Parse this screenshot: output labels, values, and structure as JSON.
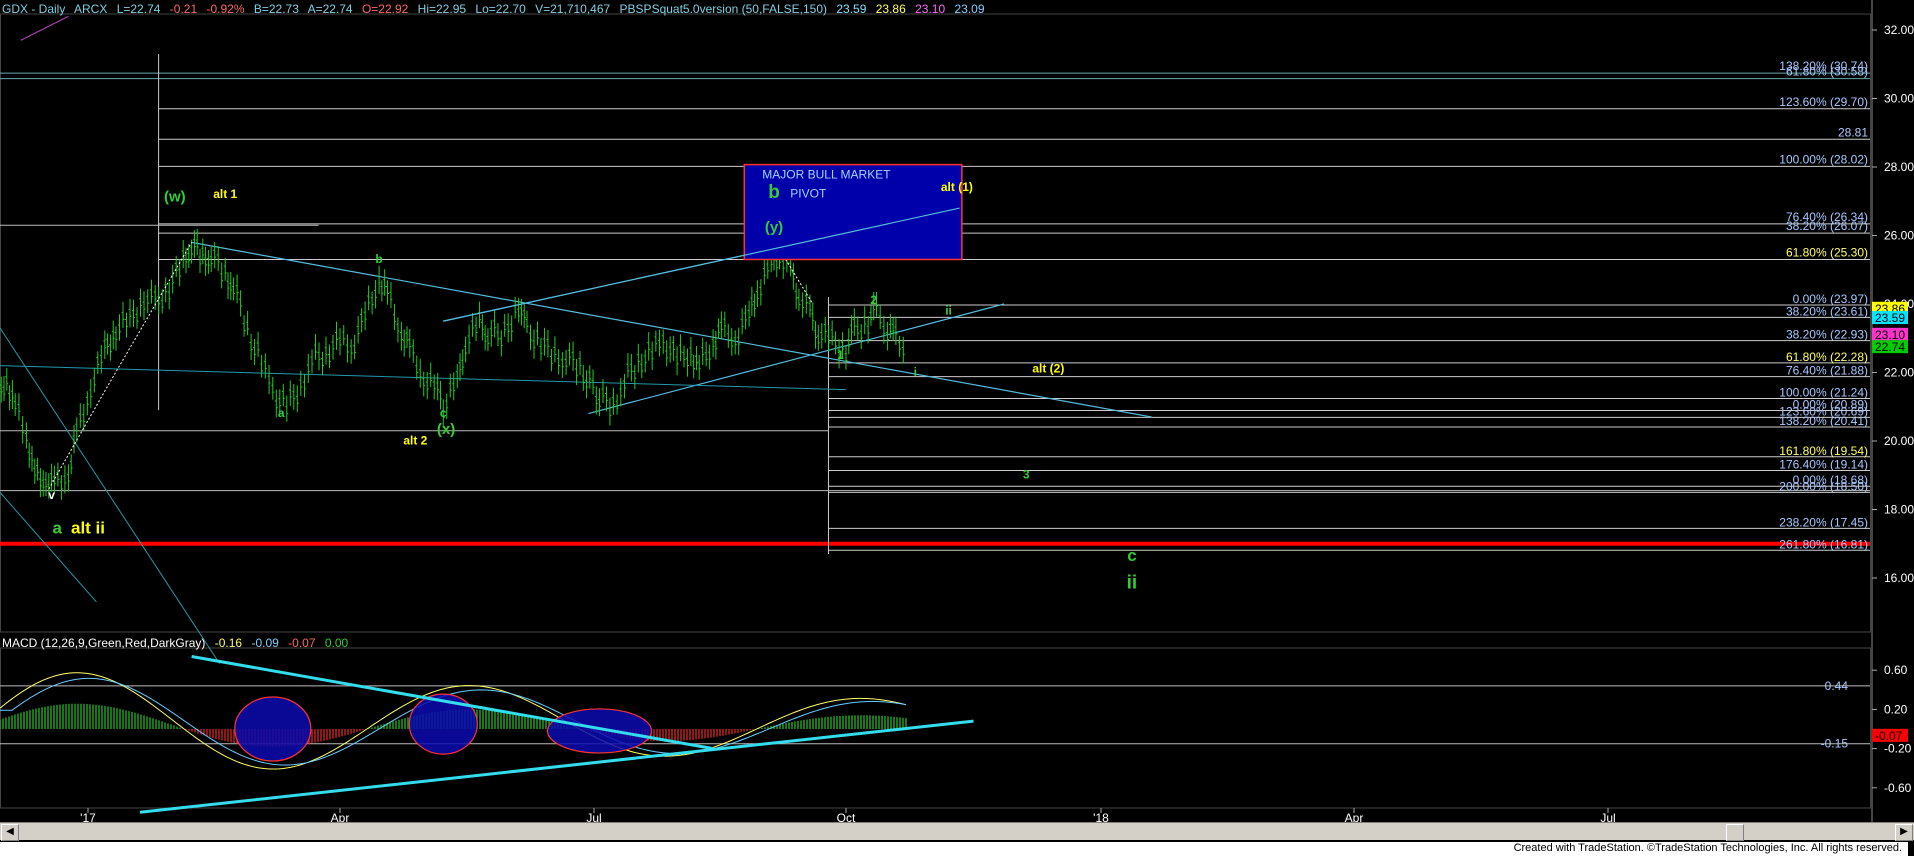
{
  "header": {
    "symbol": "GDX - Daily",
    "exchange": "ARCX",
    "last": "L=22.74",
    "change": "-0.21",
    "pct": "-0.92%",
    "bid": "B=22.73",
    "ask": "A=22.74",
    "open": "O=22.92",
    "high": "Hi=22.95",
    "low": "Lo=22.70",
    "volume": "V=21,710,467",
    "study": "PBSPSquat5.0version (50,FALSE,150)",
    "s1": "23.59",
    "s2": "23.86",
    "s3": "23.10",
    "s4": "23.09",
    "colors": {
      "s1": "#7fe0ff",
      "s2": "#ffff66",
      "s3": "#ff66ff",
      "s4": "#7fd0ff"
    }
  },
  "macd_header": {
    "label": "MACD (12,26,9,Green,Red,DarkGray)",
    "v1": "-0.16",
    "v2": "-0.09",
    "v3": "-0.07",
    "v4": "0.00"
  },
  "footer": {
    "text": "Created with TradeStation. ©TradeStation Technologies, Inc. All rights reserved."
  },
  "chart_data": [
    {
      "type": "candlestick",
      "title": "GDX - Daily",
      "x_ticks": [
        "'17",
        "Apr",
        "Jul",
        "Oct",
        "'18",
        "Apr",
        "Jul"
      ],
      "y_ticks": [
        16.0,
        18.0,
        20.0,
        22.0,
        24.0,
        26.0,
        28.0,
        30.0,
        32.0
      ],
      "ylim": [
        15.0,
        32.5
      ],
      "price_path": [
        {
          "x": "2016-12-01",
          "y": 21.4
        },
        {
          "x": "2016-12-05",
          "y": 21.8
        },
        {
          "x": "2016-12-08",
          "y": 21.0
        },
        {
          "x": "2016-12-12",
          "y": 20.2
        },
        {
          "x": "2016-12-15",
          "y": 19.0
        },
        {
          "x": "2016-12-19",
          "y": 18.9
        },
        {
          "x": "2016-12-22",
          "y": 18.7
        },
        {
          "x": "2016-12-27",
          "y": 19.1
        },
        {
          "x": "2016-12-30",
          "y": 20.2
        },
        {
          "x": "2017-01-04",
          "y": 21.6
        },
        {
          "x": "2017-01-09",
          "y": 22.6
        },
        {
          "x": "2017-01-13",
          "y": 23.3
        },
        {
          "x": "2017-01-18",
          "y": 23.5
        },
        {
          "x": "2017-01-23",
          "y": 24.2
        },
        {
          "x": "2017-01-27",
          "y": 24.0
        },
        {
          "x": "2017-02-01",
          "y": 24.5
        },
        {
          "x": "2017-02-06",
          "y": 25.2
        },
        {
          "x": "2017-02-09",
          "y": 25.8
        },
        {
          "x": "2017-02-13",
          "y": 25.3
        },
        {
          "x": "2017-02-16",
          "y": 25.5
        },
        {
          "x": "2017-02-21",
          "y": 24.8
        },
        {
          "x": "2017-02-24",
          "y": 24.6
        },
        {
          "x": "2017-03-01",
          "y": 23.2
        },
        {
          "x": "2017-03-06",
          "y": 22.3
        },
        {
          "x": "2017-03-10",
          "y": 21.4
        },
        {
          "x": "2017-03-15",
          "y": 21.0
        },
        {
          "x": "2017-03-20",
          "y": 21.6
        },
        {
          "x": "2017-03-24",
          "y": 22.4
        },
        {
          "x": "2017-03-29",
          "y": 22.6
        },
        {
          "x": "2017-04-03",
          "y": 22.9
        },
        {
          "x": "2017-04-07",
          "y": 22.7
        },
        {
          "x": "2017-04-12",
          "y": 23.6
        },
        {
          "x": "2017-04-17",
          "y": 24.8
        },
        {
          "x": "2017-04-20",
          "y": 24.3
        },
        {
          "x": "2017-04-25",
          "y": 23.2
        },
        {
          "x": "2017-04-28",
          "y": 22.7
        },
        {
          "x": "2017-05-03",
          "y": 21.9
        },
        {
          "x": "2017-05-08",
          "y": 21.4
        },
        {
          "x": "2017-05-10",
          "y": 21.0
        },
        {
          "x": "2017-05-15",
          "y": 21.7
        },
        {
          "x": "2017-05-18",
          "y": 22.9
        },
        {
          "x": "2017-05-23",
          "y": 23.4
        },
        {
          "x": "2017-05-26",
          "y": 23.2
        },
        {
          "x": "2017-06-01",
          "y": 23.1
        },
        {
          "x": "2017-06-06",
          "y": 24.0
        },
        {
          "x": "2017-06-09",
          "y": 23.2
        },
        {
          "x": "2017-06-14",
          "y": 22.9
        },
        {
          "x": "2017-06-19",
          "y": 22.4
        },
        {
          "x": "2017-06-23",
          "y": 22.5
        },
        {
          "x": "2017-06-28",
          "y": 22.1
        },
        {
          "x": "2017-07-05",
          "y": 21.3
        },
        {
          "x": "2017-07-10",
          "y": 21.0
        },
        {
          "x": "2017-07-14",
          "y": 21.8
        },
        {
          "x": "2017-07-19",
          "y": 22.3
        },
        {
          "x": "2017-07-24",
          "y": 22.6
        },
        {
          "x": "2017-07-28",
          "y": 22.9
        },
        {
          "x": "2017-08-02",
          "y": 22.4
        },
        {
          "x": "2017-08-07",
          "y": 22.6
        },
        {
          "x": "2017-08-10",
          "y": 22.2
        },
        {
          "x": "2017-08-15",
          "y": 22.9
        },
        {
          "x": "2017-08-18",
          "y": 23.3
        },
        {
          "x": "2017-08-23",
          "y": 23.0
        },
        {
          "x": "2017-08-28",
          "y": 23.6
        },
        {
          "x": "2017-08-31",
          "y": 24.4
        },
        {
          "x": "2017-09-05",
          "y": 25.1
        },
        {
          "x": "2017-09-08",
          "y": 25.5
        },
        {
          "x": "2017-09-12",
          "y": 24.9
        },
        {
          "x": "2017-09-15",
          "y": 24.3
        },
        {
          "x": "2017-09-19",
          "y": 23.7
        },
        {
          "x": "2017-09-22",
          "y": 23.2
        },
        {
          "x": "2017-09-27",
          "y": 22.9
        },
        {
          "x": "2017-10-02",
          "y": 22.7
        },
        {
          "x": "2017-10-05",
          "y": 23.2
        },
        {
          "x": "2017-10-10",
          "y": 23.5
        },
        {
          "x": "2017-10-13",
          "y": 23.8
        },
        {
          "x": "2017-10-17",
          "y": 23.3
        },
        {
          "x": "2017-10-20",
          "y": 23.0
        },
        {
          "x": "2017-10-24",
          "y": 22.74
        }
      ],
      "fib_levels_top": [
        {
          "label": "138.20% (30.74)",
          "y": 30.74
        },
        {
          "label": "61.80% (30.58)",
          "y": 30.58
        },
        {
          "label": "123.60% (29.70)",
          "y": 29.7
        },
        {
          "label": "28.81",
          "y": 28.81
        },
        {
          "label": "100.00% (28.02)",
          "y": 28.02
        },
        {
          "label": "76.40% (26.34)",
          "y": 26.34
        },
        {
          "label": "38.20% (26.07)",
          "y": 26.07
        },
        {
          "label": "61.80% (25.30)",
          "y": 25.3
        }
      ],
      "fib_levels_bottom": [
        {
          "label": "0.00% (23.97)",
          "y": 23.97
        },
        {
          "label": "38.20% (23.61)",
          "y": 23.61
        },
        {
          "label": "38.20% (22.93)",
          "y": 22.93
        },
        {
          "label": "61.80% (22.28)",
          "y": 22.28
        },
        {
          "label": "76.40% (21.88)",
          "y": 21.88
        },
        {
          "label": "100.00% (21.24)",
          "y": 21.24
        },
        {
          "label": "0.00% (20.89)",
          "y": 20.89
        },
        {
          "label": "123.60% (20.69)",
          "y": 20.69
        },
        {
          "label": "138.20% (20.41)",
          "y": 20.41
        },
        {
          "label": "161.80% (19.54)",
          "y": 19.54
        },
        {
          "label": "176.40% (19.14)",
          "y": 19.14
        },
        {
          "label": "0.00% (18.68)",
          "y": 18.68
        },
        {
          "label": "200.00% (18.50)",
          "y": 18.5
        },
        {
          "label": "238.20% (17.45)",
          "y": 17.45
        },
        {
          "label": "261.80% (16.81)",
          "y": 16.81
        }
      ],
      "price_markers": [
        {
          "label": "23.86",
          "y": 23.86,
          "color": "#ffff00",
          "text_color": "#000000"
        },
        {
          "label": "23.59",
          "y": 23.59,
          "color": "#00e5ff",
          "text_color": "#000000"
        },
        {
          "label": "23.10",
          "y": 23.1,
          "color": "#ff33cc",
          "text_color": "#000000"
        },
        {
          "label": "22.74",
          "y": 22.74,
          "color": "#00cc00",
          "text_color": "#000000"
        }
      ],
      "support_line_red": 17.0,
      "annotations": [
        {
          "text": "(w)",
          "x": "2017-02-03",
          "y": 27.0,
          "color": "#33cc33",
          "size": 15
        },
        {
          "text": "alt 1",
          "x": "2017-02-21",
          "y": 27.1,
          "color": "#ffff00",
          "size": 12
        },
        {
          "text": "b",
          "x": "2017-04-17",
          "y": 25.2,
          "color": "#33cc33",
          "size": 12
        },
        {
          "text": "a",
          "x": "2017-03-13",
          "y": 20.7,
          "color": "#33cc33",
          "size": 12
        },
        {
          "text": "c",
          "x": "2017-05-10",
          "y": 20.7,
          "color": "#33cc33",
          "size": 12
        },
        {
          "text": "(x)",
          "x": "2017-05-11",
          "y": 20.2,
          "color": "#33cc33",
          "size": 15
        },
        {
          "text": "alt 2",
          "x": "2017-04-30",
          "y": 19.9,
          "color": "#ffff00",
          "size": 12
        },
        {
          "text": "v",
          "x": "2016-12-21",
          "y": 18.3,
          "color": "#ffffff",
          "size": 12
        },
        {
          "text": "a",
          "x": "2016-12-23",
          "y": 17.3,
          "color": "#33cc33",
          "size": 17
        },
        {
          "text": "alt ii",
          "x": "2017-01-03",
          "y": 17.3,
          "color": "#ffff00",
          "size": 17
        },
        {
          "text": "b",
          "x": "2017-09-06",
          "y": 27.1,
          "color": "#33cc33",
          "size": 19
        },
        {
          "text": "(y)",
          "x": "2017-09-06",
          "y": 26.1,
          "color": "#33cc33",
          "size": 15
        },
        {
          "text": "2",
          "x": "2017-10-12",
          "y": 24.0,
          "color": "#33cc33",
          "size": 12
        },
        {
          "text": "1",
          "x": "2017-09-30",
          "y": 22.4,
          "color": "#33cc33",
          "size": 12
        },
        {
          "text": "i",
          "x": "2017-10-27",
          "y": 21.9,
          "color": "#33cc33",
          "size": 12
        },
        {
          "text": "ii",
          "x": "2017-11-08",
          "y": 23.7,
          "color": "#33cc33",
          "size": 12
        },
        {
          "text": "alt (1)",
          "x": "2017-11-11",
          "y": 27.3,
          "color": "#ffff00",
          "size": 12
        },
        {
          "text": "alt (2)",
          "x": "2017-12-14",
          "y": 22.0,
          "color": "#ffff00",
          "size": 12
        },
        {
          "text": "3",
          "x": "2017-12-06",
          "y": 18.9,
          "color": "#33cc33",
          "size": 12
        },
        {
          "text": "c",
          "x": "2018-01-13",
          "y": 16.5,
          "color": "#33cc33",
          "size": 17
        },
        {
          "text": "ii",
          "x": "2018-01-13",
          "y": 15.7,
          "color": "#33cc33",
          "size": 19
        }
      ],
      "pivot_box": {
        "line1": "MAJOR BULL MARKET",
        "line2": "PIVOT"
      }
    },
    {
      "type": "macd",
      "title": "MACD (12,26,9,Green,Red,DarkGray)",
      "y_ticks": [
        0.6,
        0.2,
        -0.2,
        -0.6
      ],
      "ylim": [
        -0.8,
        0.8
      ],
      "level_labels": [
        {
          "label": "0.44",
          "y": 0.44
        },
        {
          "label": "-0.15",
          "y": -0.15
        }
      ],
      "current_marker": {
        "label": "-0.07",
        "color": "#ff0000"
      }
    }
  ]
}
